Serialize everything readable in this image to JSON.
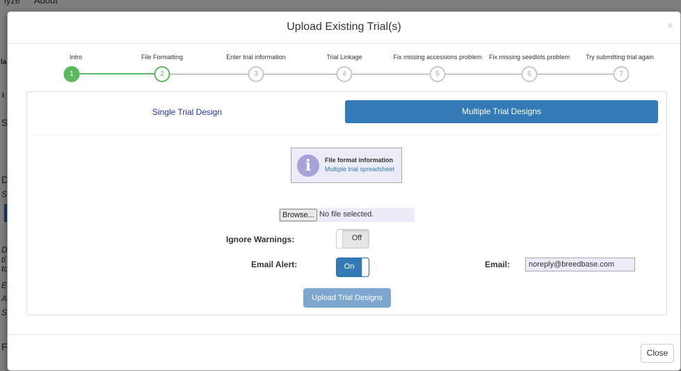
{
  "background": {
    "nav": [
      "lyze",
      "About"
    ],
    "side_fragments": [
      "la",
      "I",
      "S",
      "D",
      "S",
      "D",
      "ti",
      "tc",
      "E",
      "A",
      "S",
      "F"
    ]
  },
  "modal": {
    "title": "Upload Existing Trial(s)",
    "close_glyph": "×",
    "steps": [
      {
        "label": "Intro",
        "number": "1",
        "state": "done"
      },
      {
        "label": "File Formatting",
        "number": "2",
        "state": "active"
      },
      {
        "label": "Enter trial information",
        "number": "3",
        "state": "todo"
      },
      {
        "label": "Trial Linkage",
        "number": "4",
        "state": "todo"
      },
      {
        "label": "Fix missing accessions problem",
        "number": "5",
        "state": "todo"
      },
      {
        "label": "Fix missing seedlots problem",
        "number": "6",
        "state": "todo"
      },
      {
        "label": "Try submitting trial again",
        "number": "7",
        "state": "todo"
      }
    ],
    "tabs": {
      "single": "Single Trial Design",
      "multiple": "Multiple Trial Designs"
    },
    "info": {
      "icon": "info-icon",
      "title": "File format information",
      "link": "Multiple trial spreadsheet"
    },
    "file": {
      "browse_label": "Browse...",
      "status": "No file selected."
    },
    "ignore_warnings": {
      "label": "Ignore Warnings:",
      "value": "Off"
    },
    "email_alert": {
      "label": "Email Alert:",
      "value": "On"
    },
    "email": {
      "label": "Email:",
      "value": "noreply@breedbase.com"
    },
    "upload_button": "Upload Trial Designs",
    "close_button": "Close"
  },
  "colors": {
    "primary": "#337ab7",
    "success": "#5cb85c",
    "info_bg": "#ececf8",
    "info_icon": "#a7a3d8"
  }
}
